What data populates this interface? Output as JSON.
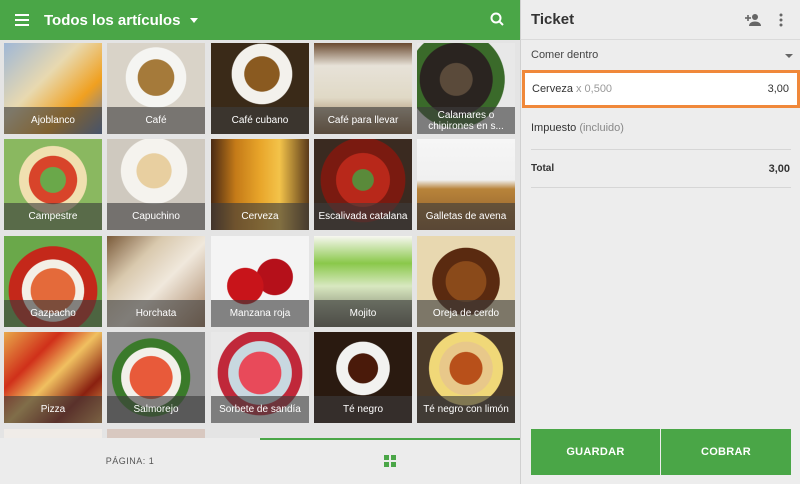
{
  "header": {
    "title": "Todos los artículos",
    "icons": {
      "menu": "menu-icon",
      "search": "search-icon",
      "caret": "chevron-down-icon"
    }
  },
  "items": [
    {
      "label": "Ajoblanco",
      "bg": "linear-gradient(135deg,#9fb7d6 0%,#e8d9b0 40%,#f0a020 70%,#5a7bb8 100%)"
    },
    {
      "label": "Café",
      "bg": "radial-gradient(circle at 50% 38%,#a57a3a 0 24%,#f5f5f2 25% 40%,#d9d3c8 41% 100%)"
    },
    {
      "label": "Café cubano",
      "bg": "radial-gradient(circle at 52% 34%,#8a5a20 0 22%,#f3f1ec 23% 38%,#3a2a18 39% 100%)"
    },
    {
      "label": "Café para llevar",
      "bg": "linear-gradient(180deg,#6a4a30 0%,#e7e2d8 25%,#e0d9c6 60%,#8a6540 100%)"
    },
    {
      "label": "Calamares o chipirones en s...",
      "bg": "radial-gradient(circle at 40% 40%,#5a4a3a 0 20%,#2a2420 21% 45%,#3a6a2a 46% 60%,#e8e8e8 61% 100%)"
    },
    {
      "label": "Campestre",
      "bg": "radial-gradient(circle at 50% 45%,#6aa84a 0 18%,#d8442a 19% 34%,#f0e0b0 35% 48%,#8ab860 49% 100%)"
    },
    {
      "label": "Capuchino",
      "bg": "radial-gradient(circle at 48% 35%,#e8cfa0 0 22%,#f5f3ee 23% 42%,#cfc9bf 43% 100%)"
    },
    {
      "label": "Cerveza",
      "bg": "linear-gradient(90deg,#4a2a14 0%,#c47a18 25%,#e8a52a 50%,#f3c34a 70%,#5a3a1a 100%)"
    },
    {
      "label": "Escalivada catalana",
      "bg": "radial-gradient(circle at 50% 45%,#5a8a3a 0 15%,#b8281a 16% 38%,#7a1a10 39% 60%,#3a2a20 61% 100%)"
    },
    {
      "label": "Galletas de avena",
      "bg": "linear-gradient(180deg,#f6f6f6 0%,#f0f0f0 45%,#b8843a 55%,#8a5a2a 100%)"
    },
    {
      "label": "Gazpacho",
      "bg": "radial-gradient(circle at 50% 60%,#e46a3a 0 30%,#f3efe6 31% 42%,#c4281a 43% 60%,#6aa84a 61% 100%)"
    },
    {
      "label": "Horchata",
      "bg": "linear-gradient(135deg,#7a5a3a 0%,#d9c9ae 30%,#f0e8dc 55%,#a58060 100%)"
    },
    {
      "label": "Manzana roja",
      "bg": "radial-gradient(circle at 35% 55%,#c8141a 0 22%,transparent 23%),radial-gradient(circle at 65% 45%,#b5101a 0 22%,#f4f4f4 23% 100%)"
    },
    {
      "label": "Mojito",
      "bg": "linear-gradient(180deg,#f7f7f0 0%,#8ac84a 30%,#d8e8c0 55%,#6a6a5a 100%)"
    },
    {
      "label": "Oreja de cerdo",
      "bg": "radial-gradient(circle at 50% 50%,#8a4a1a 0 30%,#5a2a10 31% 50%,#e8d8b0 51% 100%)"
    },
    {
      "label": "Pizza",
      "bg": "linear-gradient(135deg,#e8a84a 0%,#d0301a 30%,#f0c060 50%,#8a2010 75%,#e0a050 100%)"
    },
    {
      "label": "Salmorejo",
      "bg": "radial-gradient(circle at 45% 50%,#e85a3a 0 30%,#f2f0ea 31% 42%,#3a7a2a 43% 55%,#8a8a8a 56% 100%)"
    },
    {
      "label": "Sorbete de sandía",
      "bg": "radial-gradient(circle at 50% 45%,#e84a5a 0 30%,#c8d8e0 31% 45%,#c0283a 46% 60%,#e8e8e8 61% 100%)"
    },
    {
      "label": "Té negro",
      "bg": "radial-gradient(circle at 50% 40%,#4a1a0a 0 20%,#f2f2f0 21% 36%,#2a1a10 37% 100%)"
    },
    {
      "label": "Té negro con limón",
      "bg": "radial-gradient(circle at 50% 40%,#b8501a 0 22%,#e8c88a 23% 36%,#f0d878 37% 50%,#4a3a2a 51% 100%)"
    },
    {
      "label": "",
      "bg": "#f0ece8"
    },
    {
      "label": "",
      "bg": "#d8c8c0"
    }
  ],
  "footer": {
    "page_label": "PÁGINA: 1",
    "grid_icon": "grid-icon"
  },
  "ticket": {
    "title": "Ticket",
    "icons": {
      "add_customer": "add-customer-icon",
      "more": "more-vert-icon"
    },
    "dining_option": "Comer dentro",
    "line_items": [
      {
        "name": "Cerveza",
        "qty": "x 0,500",
        "amount": "3,00"
      }
    ],
    "tax_label": "Impuesto",
    "tax_note": "(incluido)",
    "total_label": "Total",
    "total_amount": "3,00",
    "save_label": "GUARDAR",
    "charge_label": "COBRAR"
  },
  "colors": {
    "accent": "#4aa647",
    "highlight": "#f0883a"
  }
}
